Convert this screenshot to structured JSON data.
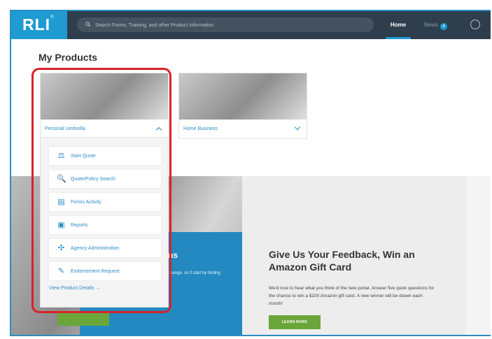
{
  "header": {
    "logo": "RLI",
    "search_placeholder": "Search Forms, Training, and other Product Information",
    "nav": {
      "home": "Home",
      "news": "News",
      "news_count": "4"
    }
  },
  "products": {
    "heading": "My Products",
    "cards": [
      {
        "label": "Personal Umbrella",
        "expanded": true
      },
      {
        "label": "Home Business",
        "expanded": false
      }
    ],
    "menu": [
      {
        "label": "Start Quote",
        "icon": "quote-icon"
      },
      {
        "label": "Quote/Policy Search",
        "icon": "search-doc-icon"
      },
      {
        "label": "Forms Activity",
        "icon": "forms-icon"
      },
      {
        "label": "Reports",
        "icon": "reports-icon"
      },
      {
        "label": "Agency Administration",
        "icon": "admin-icon"
      },
      {
        "label": "Endorsement Request",
        "icon": "endorsement-icon"
      }
    ],
    "view_details": "View Product Details →"
  },
  "promo": {
    "title_fragment": "ns",
    "text_fragment": "change, so if start by finding"
  },
  "feedback": {
    "title": "Give Us Your Feedback, Win an Amazon Gift Card",
    "text": "We'd love to hear what you think of the new portal. Answer five quick questions for the chance to win a $100 Amazon gift card. A new winner will be drawn each month!",
    "button": "LEARN MORE"
  },
  "colors": {
    "accent": "#2b8cc4",
    "topbar": "#2e3e4c",
    "highlight": "#d9222a",
    "cta": "#6aa63a"
  }
}
